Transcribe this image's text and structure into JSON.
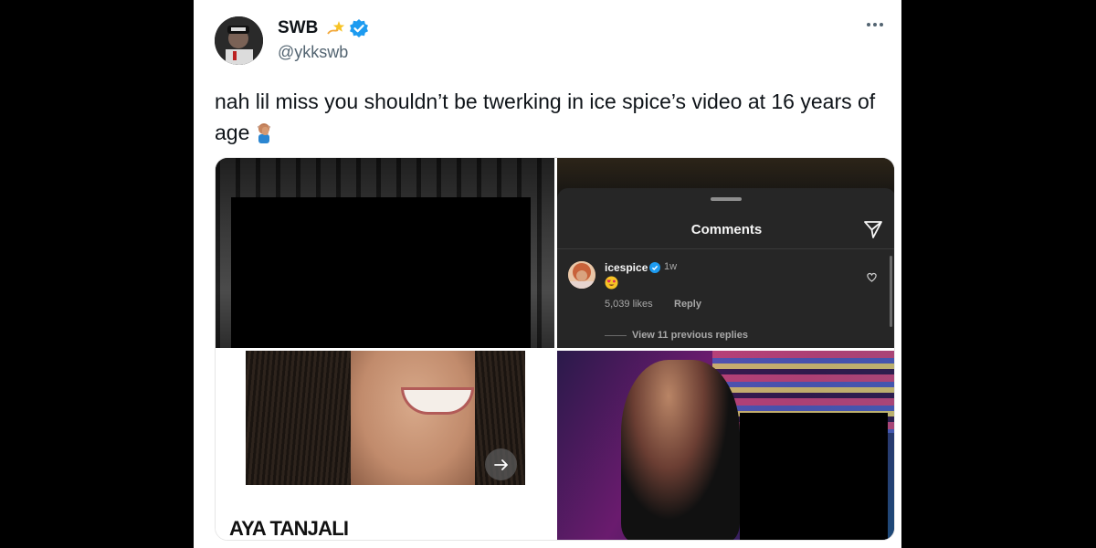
{
  "tweet": {
    "display_name": "SWB",
    "handle": "@ykkswb",
    "text": "nah lil miss you shouldn’t be twerking in ice spice’s video at 16 years of age",
    "emoji_icon": "person-facepalming-icon",
    "badge_icon": "dizzy-star-icon",
    "verified_color": "#1d9bf0"
  },
  "media": {
    "comments_panel": {
      "title": "Comments",
      "username": "icespice",
      "time": "1w",
      "likes": "5,039 likes",
      "reply_label": "Reply",
      "view_replies": "View 11 previous replies"
    },
    "caption": "AYA TANJALI"
  },
  "colors": {
    "page_background": "#000000",
    "card_background": "#ffffff",
    "text_primary": "#0f1419",
    "text_secondary": "#536471",
    "comments_background": "#262626"
  }
}
